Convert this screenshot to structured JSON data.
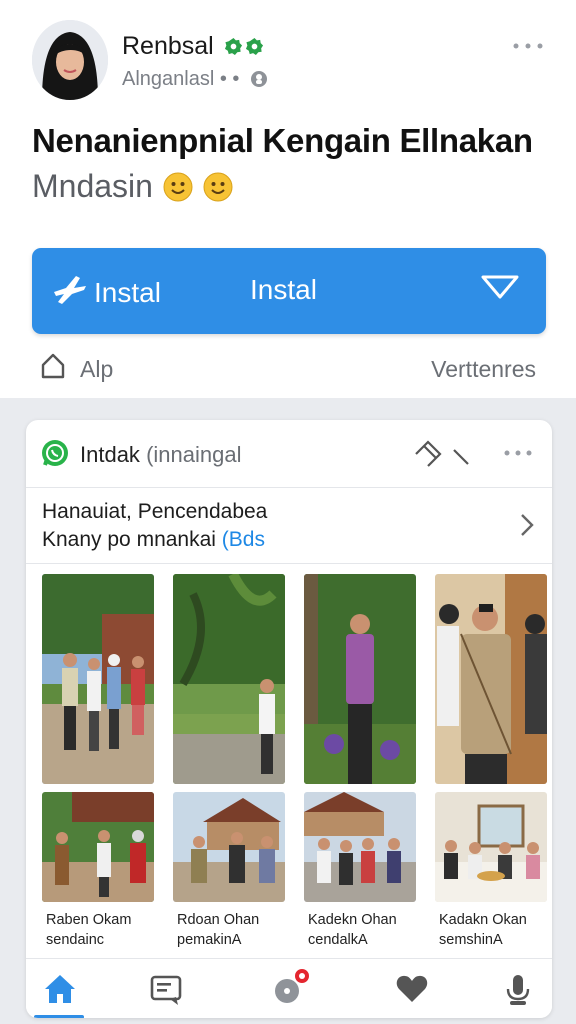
{
  "header": {
    "user_name": "Renbsal",
    "user_subtitle": "Alnganlasl • •",
    "headline": "Nenanienpnial Kengain Ellnakan",
    "subline": "Mndasin"
  },
  "install_button": {
    "left_label": "Instal",
    "center_label": "Instal"
  },
  "app_row": {
    "left_label": "Alp",
    "right_label": "Verttenres"
  },
  "card": {
    "title": "Intdak",
    "title_sub": "(innaingal",
    "note_line1": "Нanauiat, Pencendabea",
    "note_line2": "Knany po mnankai",
    "note_link": "(Вds",
    "photos": [
      {
        "caption1": "Raben Okam",
        "caption2": "sendainc"
      },
      {
        "caption1": "Rdoan Ohan",
        "caption2": "pemakinА"
      },
      {
        "caption1": "Kadekn Ohan",
        "caption2": "cendalkА"
      },
      {
        "caption1": "Kadakn Okan",
        "caption2": "semshinА"
      }
    ]
  },
  "icons": {
    "verified": "verified-badge-icon",
    "globe": "globe-icon",
    "more": "more-dots-icon",
    "install": "airplane-icon",
    "caret": "triangle-down-icon",
    "app": "house-outline-icon",
    "whatsapp": "whatsapp-icon",
    "share": "share-arrows-icon",
    "chevron": "chevron-right-icon",
    "nav": [
      "home-icon",
      "chat-icon",
      "notification-icon",
      "heart-icon",
      "mic-icon"
    ]
  },
  "colors": {
    "accent": "#2f8ee6",
    "verified": "#2aa14a",
    "badge": "#e4262f"
  }
}
